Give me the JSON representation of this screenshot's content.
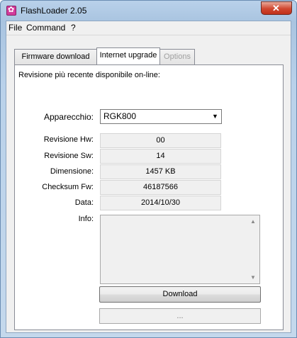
{
  "window": {
    "title": "FlashLoader 2.05"
  },
  "menu": {
    "items": [
      "File",
      "Command",
      "?"
    ]
  },
  "tabs": [
    {
      "label": "Firmware download"
    },
    {
      "label": "Internet upgrade"
    },
    {
      "label": "Options"
    }
  ],
  "panel": {
    "heading": "Revisione più recente disponibile on-line:",
    "device_label": "Apparecchio:",
    "device_value": "RGK800",
    "fields": [
      {
        "label": "Revisione Hw:",
        "value": "00"
      },
      {
        "label": "Revisione Sw:",
        "value": "14"
      },
      {
        "label": "Dimensione:",
        "value": "1457 KB"
      },
      {
        "label": "Checksum Fw:",
        "value": "46187566"
      },
      {
        "label": "Data:",
        "value": "2014/10/30"
      }
    ],
    "info_label": "Info:",
    "info_text": "",
    "download_label": "Download",
    "status_text": "..."
  }
}
